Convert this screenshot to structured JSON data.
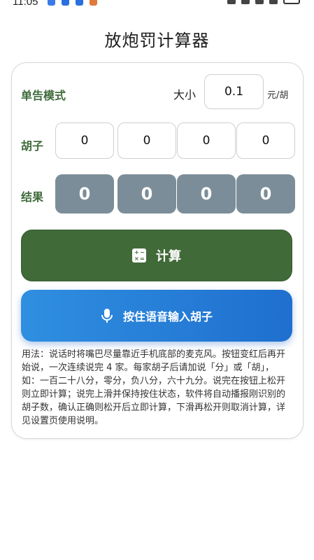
{
  "status_bar": {
    "time": "11:05"
  },
  "app": {
    "title": "放炮罚计算器"
  },
  "mode": {
    "label": "单告模式"
  },
  "size": {
    "label": "大小",
    "value": "0.1",
    "unit": "元/胡"
  },
  "hu": {
    "label": "胡子",
    "values": [
      "0",
      "0",
      "0",
      "0"
    ]
  },
  "result": {
    "label": "结果",
    "values": [
      "0",
      "0",
      "0",
      "0"
    ]
  },
  "buttons": {
    "calculate": "计算",
    "voice": "按住语音输入胡子"
  },
  "usage": "用法：说话时将嘴巴尽量靠近手机底部的麦克风。按钮变红后再开始说，一次连续说完 4 家。每家胡子后请加说「分」或「胡」，如：一百二十八分，零分，负八分，六十九分。说完在按钮上松开则立即计算；说完上滑并保持按住状态，软件将自动播报刚识别的胡子数，确认正确则松开后立即计算，下滑再松开则取消计算，详见设置页使用说明。",
  "colors": {
    "accent_green": "#416a39",
    "label_green": "#3f6b3a",
    "result_gray": "#7b8d98",
    "voice_blue": "#1f6fcf"
  },
  "icons": {
    "calc": "calculator-icon",
    "voice": "microphone-icon"
  }
}
